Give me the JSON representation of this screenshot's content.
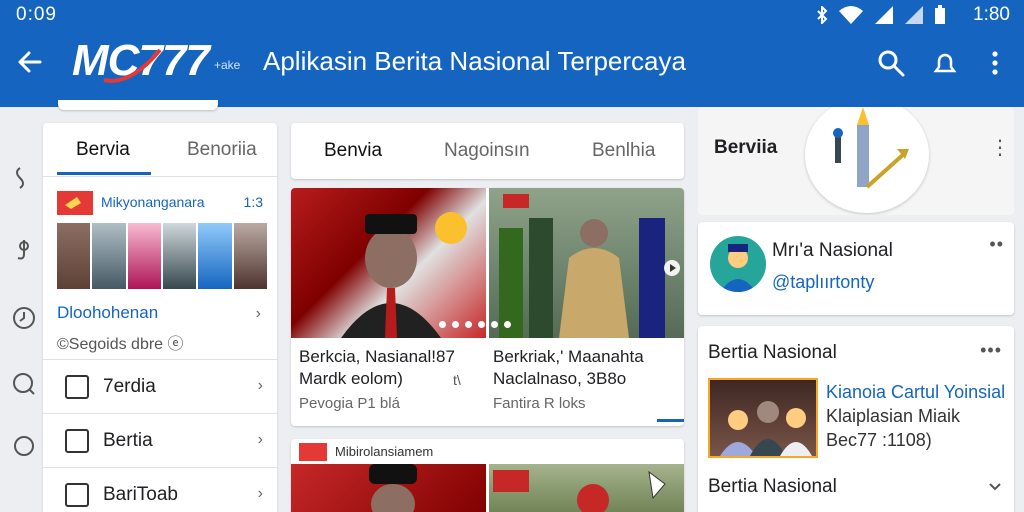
{
  "status_bar": {
    "time_left": "0:09",
    "time_right": "1:80"
  },
  "app_bar": {
    "logo": "MC777",
    "logo_sub": "+ake",
    "title": "Aplikasin Berita Nasional Terpercaya",
    "icons": [
      "back-arrow-icon",
      "search-icon",
      "bell-icon",
      "more-vert-icon"
    ]
  },
  "colors": {
    "primary": "#1565c0",
    "accent": "#e53935",
    "background": "#eceef1"
  },
  "left_card": {
    "tabs": [
      "Bervia",
      "Benoriia"
    ],
    "active_tab": 0,
    "publisher": {
      "name": "Mikyonanganara",
      "count": "1:3"
    },
    "strip_link": "Dloohohenan",
    "strip_sub": "©Segoids dbre ⓔ",
    "menu": [
      {
        "label": "7erdia",
        "icon": "newspaper-icon"
      },
      {
        "label": "Bertia",
        "icon": "list-icon"
      },
      {
        "label": "BariToab",
        "icon": "media-icon"
      }
    ]
  },
  "center": {
    "tabs": [
      "Benvia",
      "Nagoinsın",
      "Benlhia"
    ],
    "news": [
      {
        "title_line1": "Berkcia, Nasianal!87",
        "title_line2": "Mardk eolom)",
        "extra": "t\\",
        "meta": "Pevogia P1 blá"
      },
      {
        "title_line1": "Berkriak,' Maanahta",
        "title_line2": "Naclalnaso, 3B8o",
        "meta": "Fantira R loks"
      }
    ],
    "news2_label": "Mibirolansiamem"
  },
  "right": {
    "top_label": "Berviia",
    "profile": {
      "name": "Mrı'a Nasional",
      "handle": "@taplıırtonty"
    },
    "news_section": {
      "title": "Bertia Nasional",
      "item": {
        "title": "Kianoia Cartul Yoinsial",
        "line2": "Klaiplasian Miaik",
        "line3": "Bec77 :1108)"
      },
      "footer": "Bertia Nasional"
    }
  }
}
